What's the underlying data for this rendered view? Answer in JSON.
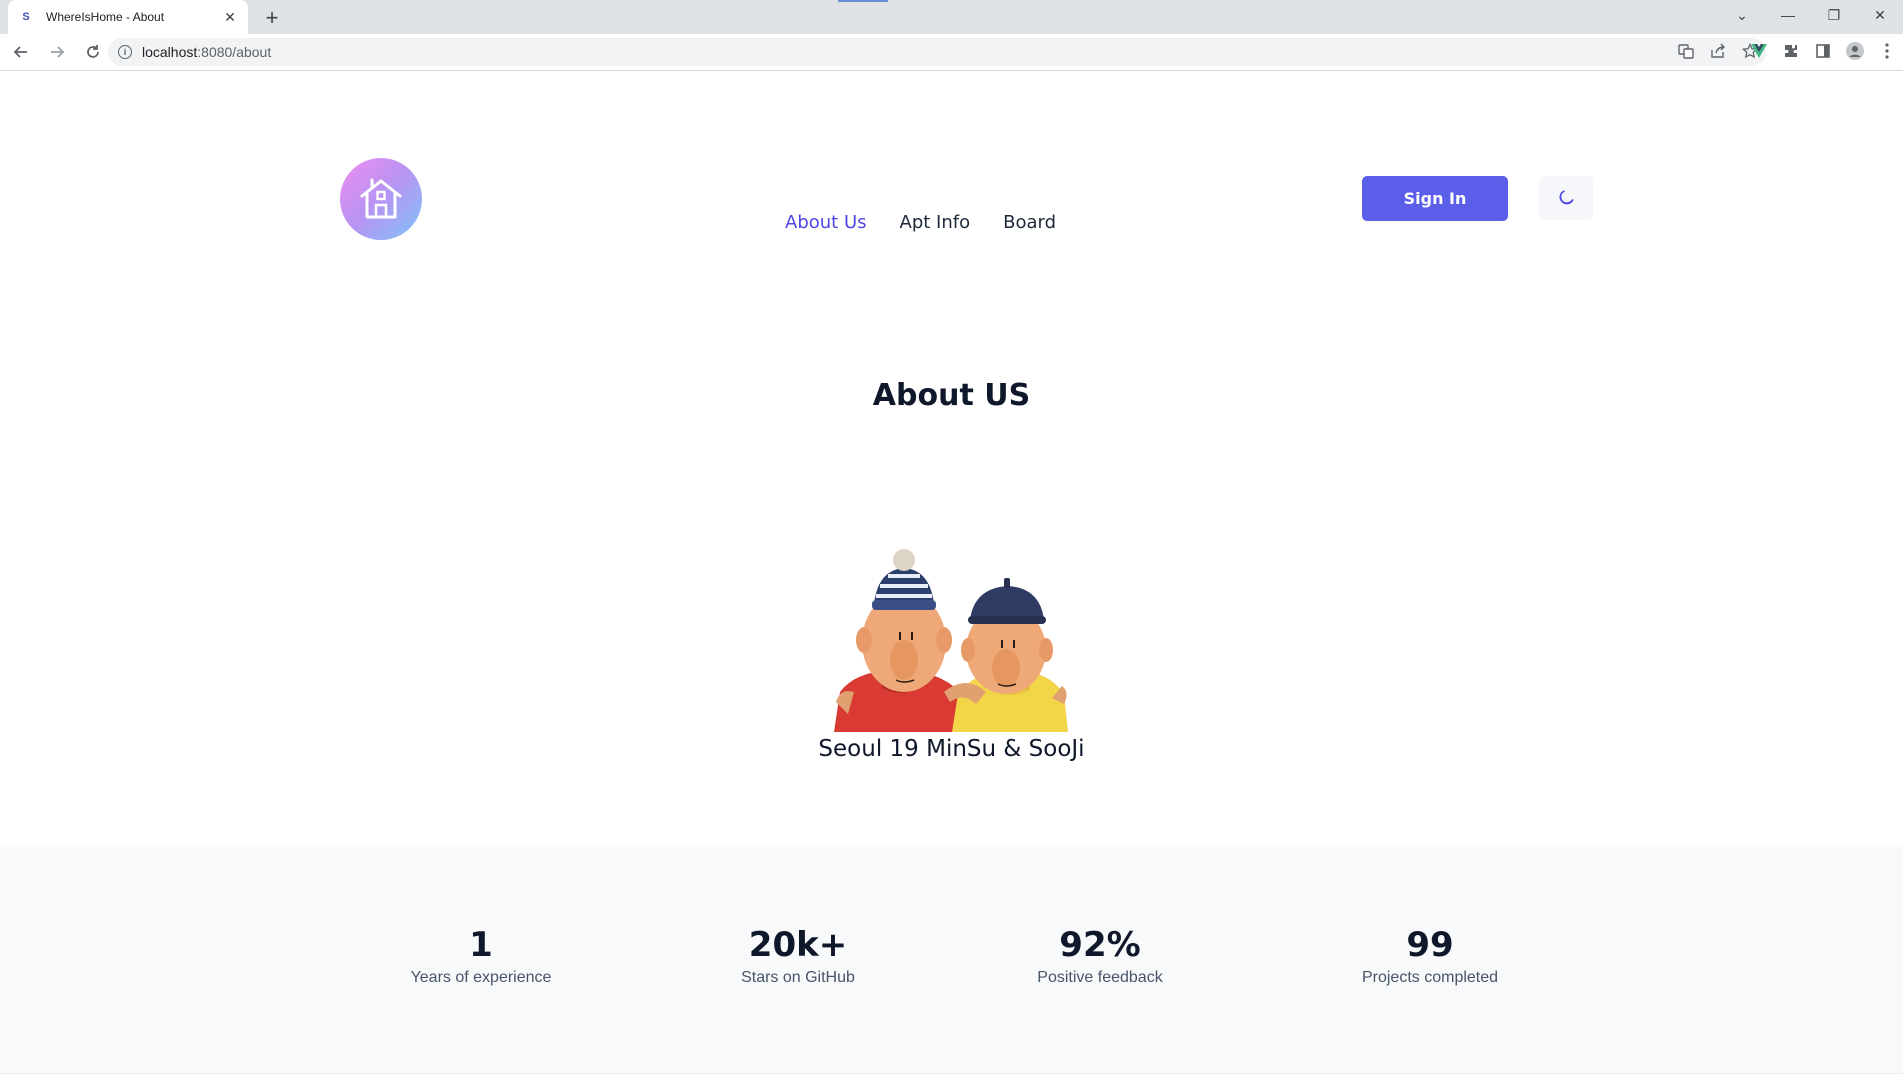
{
  "browser": {
    "tab_title": "WhereIsHome - About",
    "favicon_letter": "S",
    "tab_close": "✕",
    "new_tab": "+",
    "url_host": "localhost",
    "url_rest": ":8080/about",
    "window_controls": [
      "⌄",
      "—",
      "❐",
      "✕"
    ]
  },
  "header": {
    "nav": [
      {
        "label": "About Us",
        "active": true
      },
      {
        "label": "Apt Info",
        "active": false
      },
      {
        "label": "Board",
        "active": false
      }
    ],
    "signin_label": "Sign In",
    "theme_icon": "moon-icon",
    "logo_icon": "house-icon",
    "accent_color": "#5b5ee8"
  },
  "about": {
    "title": "About US",
    "caption": "Seoul 19 MinSu & SooJi"
  },
  "stats": [
    {
      "value": "1",
      "label": "Years of experience"
    },
    {
      "value": "20k+",
      "label": "Stars on GitHub"
    },
    {
      "value": "92%",
      "label": "Positive feedback"
    },
    {
      "value": "99",
      "label": "Projects completed"
    }
  ]
}
